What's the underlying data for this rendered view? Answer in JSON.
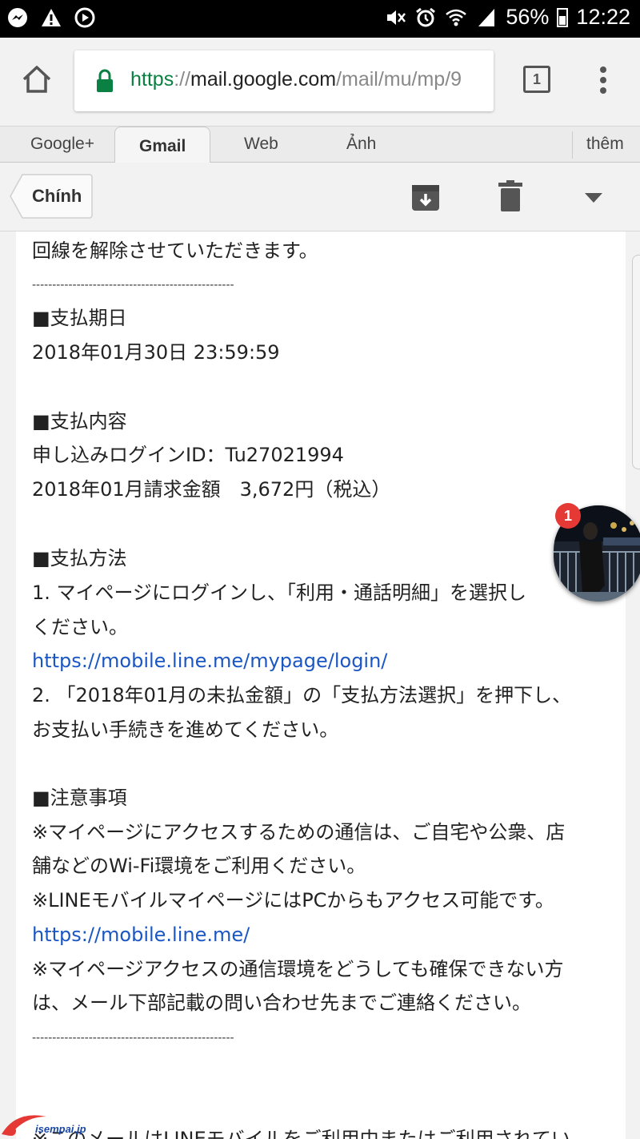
{
  "status_bar": {
    "battery": "56%",
    "time": "12:22",
    "left_icons": [
      "messenger-icon",
      "warning-icon",
      "sync-icon"
    ],
    "right_icons": [
      "mute-icon",
      "alarm-icon",
      "wifi-icon",
      "signal-icon",
      "battery-icon"
    ]
  },
  "browser": {
    "url_scheme": "https",
    "url_sep": "://",
    "url_host": "mail.google.com",
    "url_path": "/mail/mu/mp/9",
    "tab_count": "1"
  },
  "google_tabs": [
    "Google+",
    "Gmail",
    "Web",
    "Ảnh",
    "thêm"
  ],
  "gmail_bar": {
    "back_label": "Chính",
    "icons": [
      "archive-icon",
      "trash-icon",
      "more-caret-icon"
    ]
  },
  "email_lines": [
    "回線を解除させていただきます。",
    "--------------------------------------------------",
    "■支払期日",
    "2018年01月30日 23:59:59",
    "■支払内容",
    "申し込みログインID：Tu27021994",
    "2018年01月請求金額　3,672円（税込）",
    "■支払方法",
    "1. マイページにログインし、「利用・通話明細」を選択し",
    "ください。",
    "https://mobile.line.me/mypage/login/",
    "2. 「2018年01月の未払金額」の「支払方法選択」を押下し、",
    "お支払い手続きを進めてください。",
    "■注意事項",
    "※マイページにアクセスするための通信は、ご自宅や公衆、店",
    "舗などのWi-Fi環境をご利用ください。",
    "※LINEモバイルマイページにはPCからもアクセス可能です。",
    "https://mobile.line.me/",
    "※マイページアクセスの通信環境をどうしても確保できない方",
    "は、メール下部記載の問い合わせ先までご連絡ください。",
    "--------------------------------------------------",
    "※このメールはLINEモバイルをご利用中またはご利用されてい"
  ],
  "chat_head": {
    "badge": "1"
  },
  "watermark": {
    "text": "isempai.jp"
  },
  "colors": {
    "link": "#1a56c4",
    "https_green": "#0b8043",
    "badge_red": "#e53935"
  }
}
